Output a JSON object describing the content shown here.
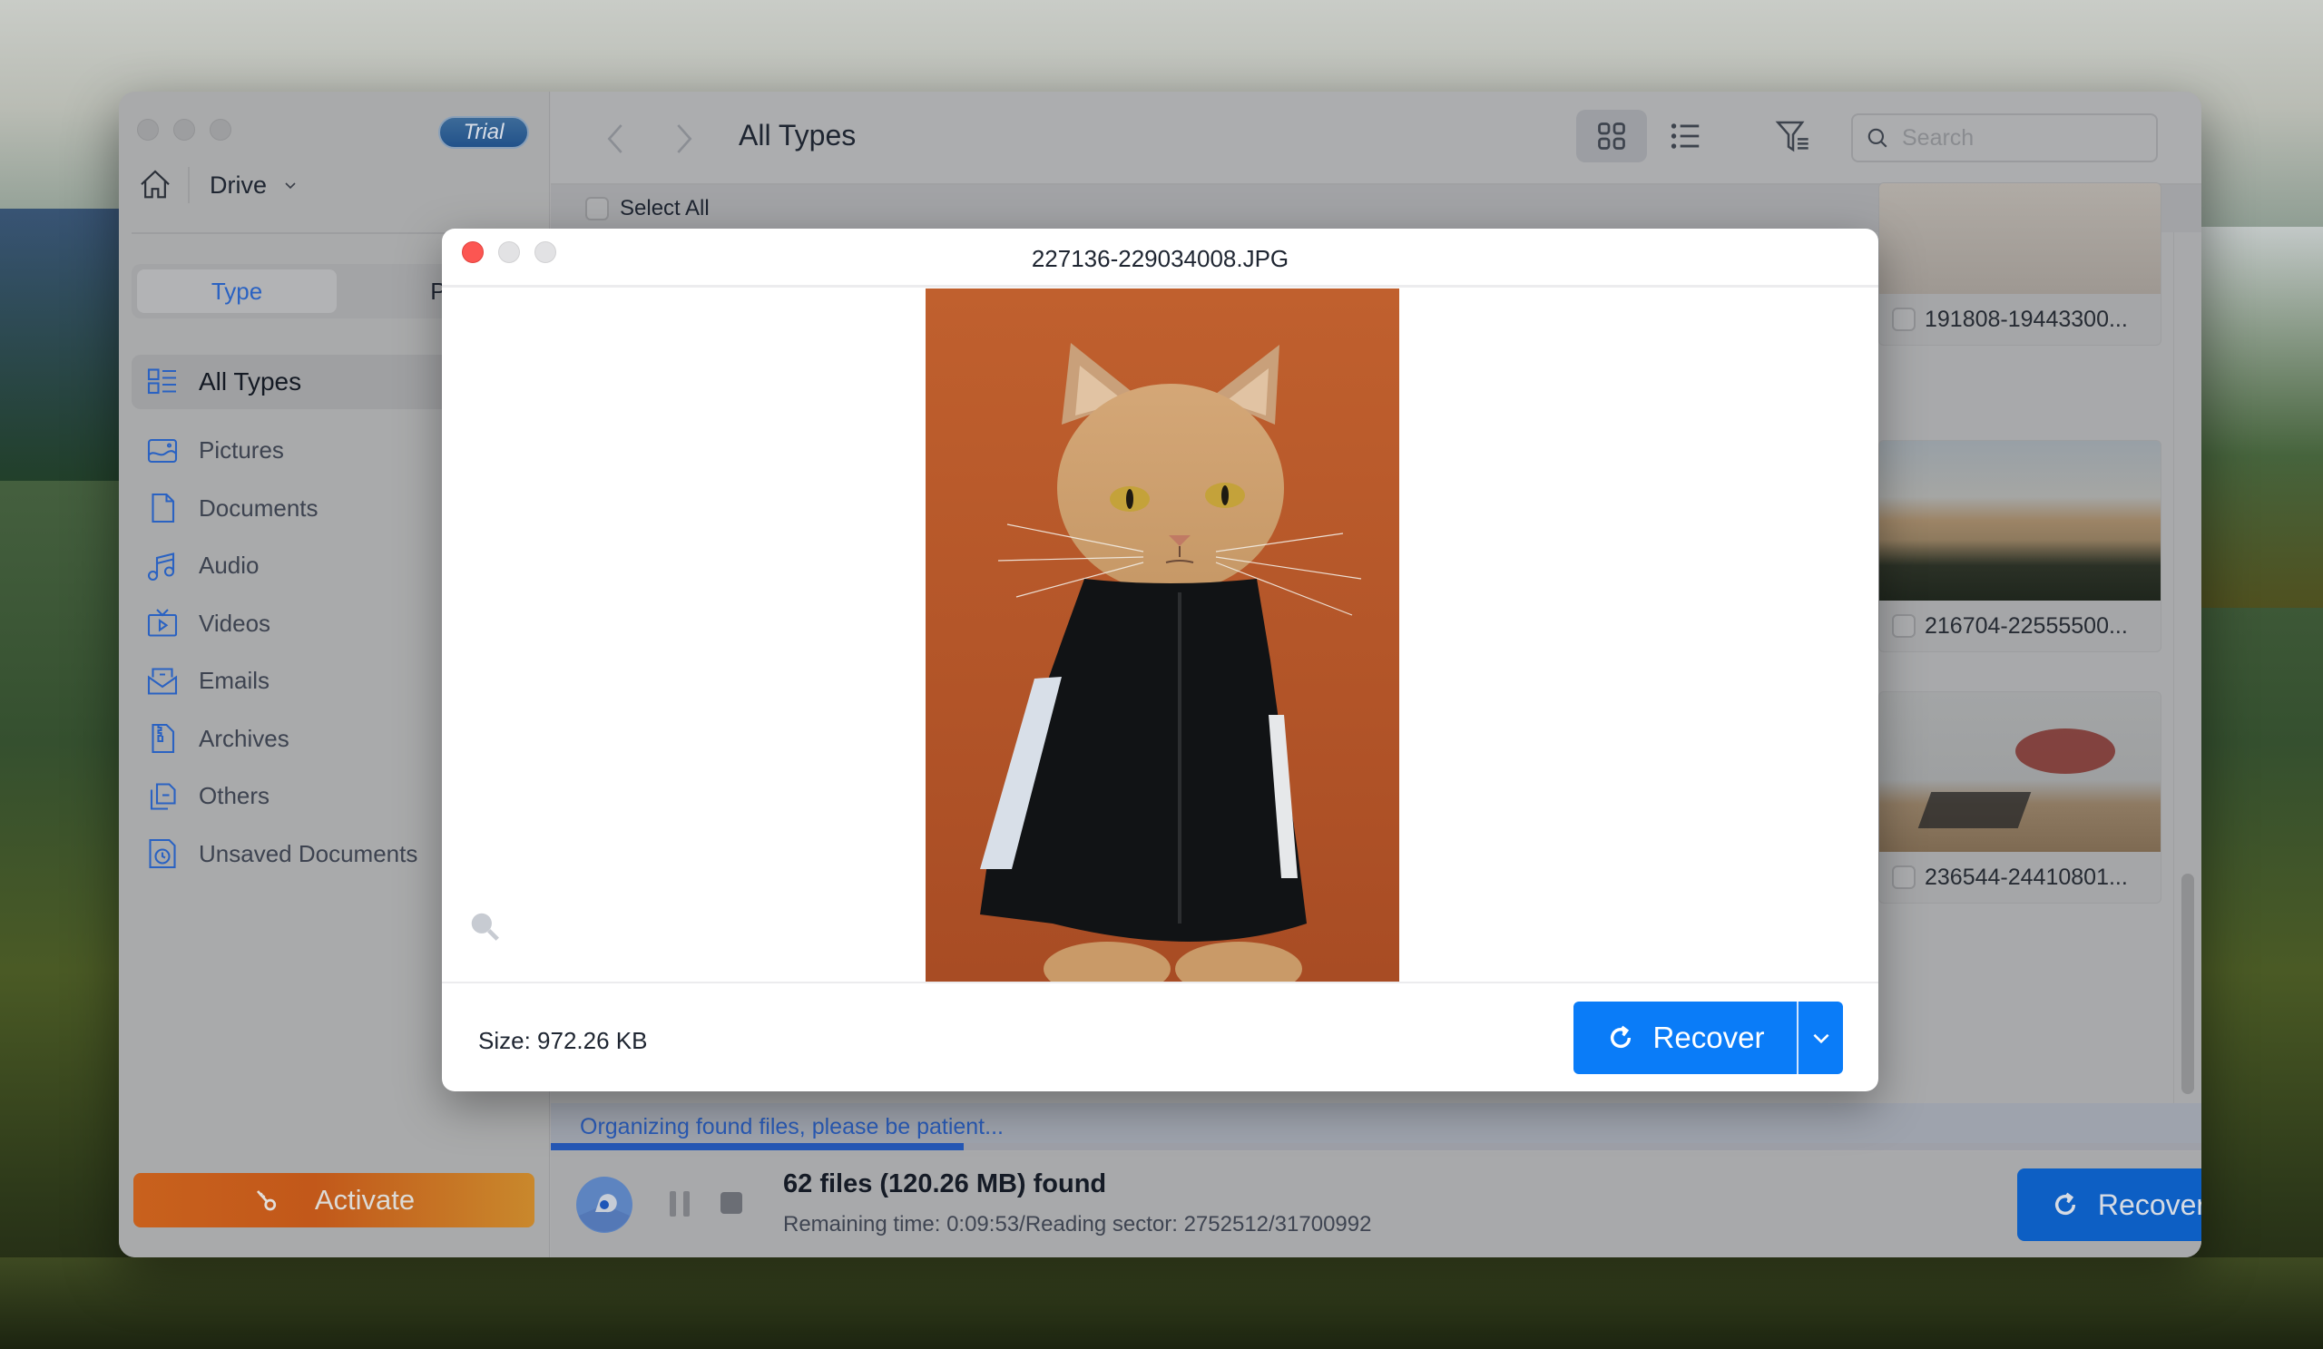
{
  "sidebar": {
    "trial_badge": "Trial",
    "drive_label": "Drive",
    "tabs": [
      {
        "label": "Type",
        "active": true
      },
      {
        "label": "Path",
        "active": false
      }
    ],
    "items": [
      {
        "label": "All Types",
        "icon": "all-types-icon",
        "active": true
      },
      {
        "label": "Pictures",
        "icon": "picture-icon"
      },
      {
        "label": "Documents",
        "icon": "document-icon"
      },
      {
        "label": "Audio",
        "icon": "music-note-icon"
      },
      {
        "label": "Videos",
        "icon": "video-icon"
      },
      {
        "label": "Emails",
        "icon": "email-icon"
      },
      {
        "label": "Archives",
        "icon": "archive-icon"
      },
      {
        "label": "Others",
        "icon": "others-icon"
      },
      {
        "label": "Unsaved Documents",
        "icon": "unsaved-document-icon"
      }
    ],
    "activate_label": "Activate"
  },
  "toolbar": {
    "title": "All Types",
    "search_placeholder": "Search",
    "view_mode": "grid"
  },
  "select_all_label": "Select All",
  "files": [
    {
      "name": "191808-19443300...",
      "checked": false
    },
    {
      "name": "216704-22555500...",
      "checked": false
    },
    {
      "name": "236544-24410801...",
      "checked": false
    }
  ],
  "status": {
    "message": "Organizing found files, please be patient...",
    "progress_percent": 25,
    "found": "62 files (120.26 MB) found",
    "remaining": "Remaining time: 0:09:53/Reading sector: 2752512/31700992",
    "recover_label": "Recover"
  },
  "preview_modal": {
    "title": "227136-229034008.JPG",
    "size": "Size: 972.26 KB",
    "recover_label": "Recover"
  },
  "colors": {
    "accent_blue": "#0a7cf8",
    "activate_orange": "#c8611d",
    "close_red": "#fc5652"
  }
}
